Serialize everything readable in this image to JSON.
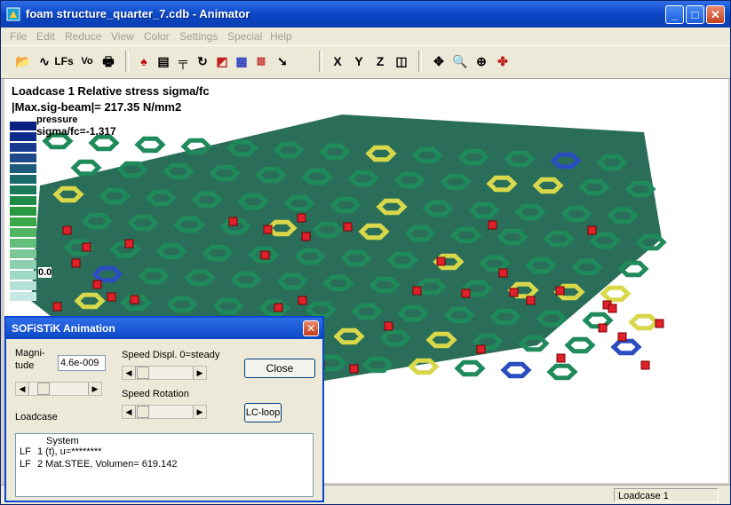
{
  "window": {
    "title": "foam structure_quarter_7.cdb - Animator"
  },
  "menu": [
    "File",
    "Edit",
    "Reduce",
    "View",
    "Color",
    "Settings",
    "Special",
    "Help"
  ],
  "toolbar": {
    "lf_label": "LFs",
    "vo_label": "Vo",
    "x_label": "X",
    "y_label": "Y",
    "z_label": "Z"
  },
  "viewport": {
    "loadcase_line": "Loadcase    1  Relative stress sigma/fc",
    "max_line": "|Max.sig-beam|=  217.35 N/mm2",
    "pressure_label": "pressure",
    "sigma_label": "sigma/fc=-1.317",
    "legend_tick": "0.0",
    "legend_colors": [
      "#0a2080",
      "#0c2a8a",
      "#1a3a90",
      "#1e4a88",
      "#1d5a7c",
      "#1a6a6c",
      "#187a5a",
      "#208a48",
      "#2a9a40",
      "#3aa848",
      "#50b462",
      "#64be7c",
      "#7ac696",
      "#8ecfb0",
      "#a0d8c6",
      "#b4e0d6",
      "#c6e8e2"
    ],
    "accent_colors": {
      "beam_green": "#1f8a5a",
      "beam_yellow": "#d8d84a",
      "node_red": "#e0202a",
      "beam_blue": "#2a4ec0"
    }
  },
  "dialog": {
    "title": "SOFiSTiK Animation",
    "magnitude_label_1": "Magni-",
    "magnitude_label_2": "tude",
    "magnitude_value": "4.6e-009",
    "speed_displ_label": "Speed Displ. 0=steady",
    "speed_rotation_label": "Speed Rotation",
    "close_button": "Close",
    "lcloop_button": "LC-loop",
    "loadcase_label": "Loadcase",
    "list_header": "System",
    "list_rows": [
      {
        "type": "LF",
        "text": "1 (t), u=********"
      },
      {
        "type": "LF",
        "text": "2 Mat.STEE, Volumen=    619.142"
      }
    ]
  },
  "status": {
    "loadcase": "Loadcase    1"
  }
}
